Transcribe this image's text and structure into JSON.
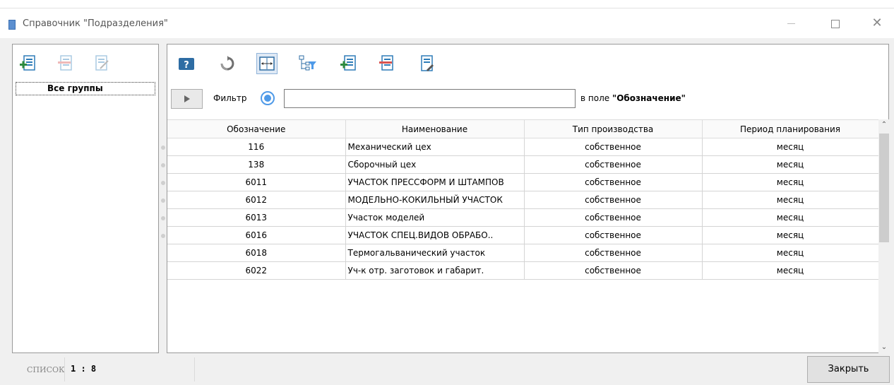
{
  "window": {
    "title": "Справочник \"Подразделения\"",
    "close_glyph": "✕"
  },
  "left_panel": {
    "toolbar_icons": [
      "add-group-icon",
      "delete-group-icon",
      "edit-group-icon"
    ],
    "group_item": "Все группы"
  },
  "toolbar": {
    "icons": [
      "help-icon",
      "refresh-icon",
      "fit-columns-icon",
      "tree-filter-icon",
      "add-record-icon",
      "delete-record-icon",
      "export-icon"
    ],
    "pressed_icon": "fit-columns-icon"
  },
  "filter": {
    "label": "Фильтр",
    "value": "",
    "field_prefix": "в поле",
    "field_name": "\"Обозначение\""
  },
  "table": {
    "columns": [
      "Обозначение",
      "Наименование",
      "Тип производства",
      "Период планирования"
    ],
    "rows": [
      [
        "116",
        "Механический цех",
        "собственное",
        "месяц"
      ],
      [
        "138",
        "Сборочный цех",
        "собственное",
        "месяц"
      ],
      [
        "6011",
        "УЧАСТОК ПРЕССФОРМ И ШТАМПОВ",
        "собственное",
        "месяц"
      ],
      [
        "6012",
        "МОДЕЛЬНО-КОКИЛЬНЫЙ УЧАСТОК",
        "собственное",
        "месяц"
      ],
      [
        "6013",
        "Участок моделей",
        "собственное",
        "месяц"
      ],
      [
        "6016",
        "УЧАСТОК СПЕЦ.ВИДОВ ОБРАБО..",
        "собственное",
        "месяц"
      ],
      [
        "6018",
        "Термогальванический участок",
        "собственное",
        "месяц"
      ],
      [
        "6022",
        "Уч-к отр. заготовок и габарит.",
        "собственное",
        "месяц"
      ]
    ]
  },
  "status": {
    "mode": "СПИСОК",
    "ratio": "1 : 8"
  },
  "buttons": {
    "close": "Закрыть"
  },
  "colors": {
    "accent": "#4f9ae8",
    "add_green": "#2e8b3e",
    "delete_red": "#d9534f"
  }
}
